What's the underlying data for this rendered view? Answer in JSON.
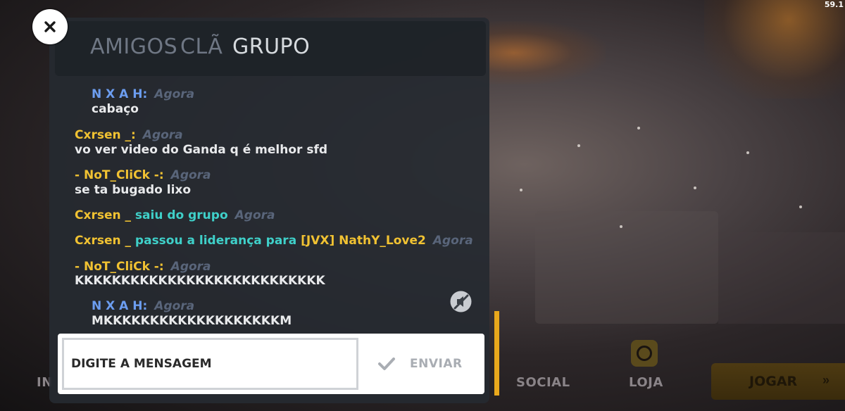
{
  "status": {
    "fps": "59.1"
  },
  "tabs": [
    {
      "label": "AMIGOS",
      "active": false
    },
    {
      "label": "CLÃ",
      "active": false
    },
    {
      "label": "GRUPO",
      "active": true
    }
  ],
  "messages": [
    {
      "sender": "N X A H:",
      "time": "Agora",
      "text": "cabaço"
    },
    {
      "sender": "Cxrsen _:",
      "time": "Agora",
      "text": "vo ver video do Ganda q é melhor sfd"
    },
    {
      "sender": "- NoT_CliCk -:",
      "time": "Agora",
      "text": "se ta bugado lixo"
    },
    {
      "sender": "Cxrsen _",
      "action": "saiu do grupo",
      "time": "Agora"
    },
    {
      "sender": "Cxrsen _",
      "action": "passou a liderança para",
      "target": "[JVX] NathY_Love2",
      "time": "Agora"
    },
    {
      "sender": "- NoT_CliCk -:",
      "time": "Agora",
      "text": "KKKKKKKKKKKKKKKKKKKKKKKKKKK"
    },
    {
      "sender": "N X A H:",
      "time": "Agora",
      "text": "MKKKKKKKKKKKKKKKKKKKM"
    }
  ],
  "input": {
    "placeholder": "DIGITE A MENSAGEM",
    "value": ""
  },
  "send_button": {
    "label": "ENVIAR"
  },
  "bottom_nav": {
    "partial_left": "IN",
    "social": "SOCIAL",
    "loja": "LOJA",
    "jogar": "JOGAR"
  },
  "colors": {
    "sender_blue": "#6c9df0",
    "sender_yellow": "#f1c232",
    "system_cyan": "#3fd0c9",
    "timestamp": "#59657a",
    "accent_yellow": "#e9a81c"
  },
  "icons": {
    "close": "close-icon",
    "mute": "mute-icon",
    "send": "check-icon",
    "loja": "stopwatch-icon",
    "jogar": "double-chevron-icon"
  }
}
